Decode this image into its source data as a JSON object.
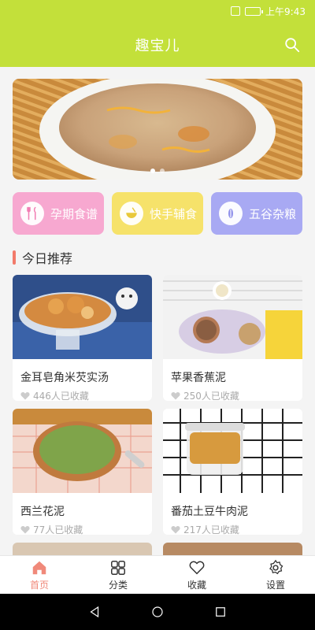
{
  "status_bar": {
    "time": "上午9:43"
  },
  "header": {
    "title": "趣宝儿"
  },
  "banner": {
    "dots": 2,
    "active_dot": 1
  },
  "categories": [
    {
      "label": "孕期食谱",
      "icon": "utensils-icon",
      "color": "#f7a8d0"
    },
    {
      "label": "快手辅食",
      "icon": "bowl-icon",
      "color": "#f6e26a"
    },
    {
      "label": "五谷杂粮",
      "icon": "grain-icon",
      "color": "#a8a9f3"
    }
  ],
  "section": {
    "title": "今日推荐"
  },
  "recipes": [
    {
      "name": "金耳皂角米芡实汤",
      "favorites": "446人已收藏"
    },
    {
      "name": "苹果香蕉泥",
      "favorites": "250人已收藏"
    },
    {
      "name": "西兰花泥",
      "favorites": "77人已收藏"
    },
    {
      "name": "番茄土豆牛肉泥",
      "favorites": "217人已收藏"
    }
  ],
  "tabs": [
    {
      "label": "首页",
      "icon": "home-icon",
      "active": true
    },
    {
      "label": "分类",
      "icon": "grid-icon",
      "active": false
    },
    {
      "label": "收藏",
      "icon": "heart-icon",
      "active": false
    },
    {
      "label": "设置",
      "icon": "gear-icon",
      "active": false
    }
  ],
  "colors": {
    "accent": "#c3e03a",
    "active_tab": "#f0897a"
  }
}
